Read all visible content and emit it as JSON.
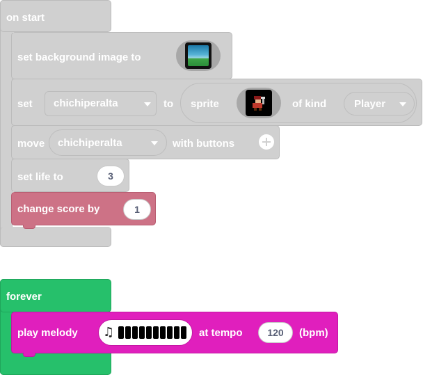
{
  "on_start": {
    "hat_label": "on start",
    "set_background": {
      "label": "set background image to",
      "image_icon": "background-image-thumbnail-icon"
    },
    "set_sprite": {
      "set_label": "set",
      "variable": "chichiperalta",
      "to_label": "to",
      "sprite_label": "sprite",
      "sprite_icon": "pixel-character-sprite-icon",
      "of_kind_label": "of kind",
      "kind": "Player"
    },
    "move": {
      "label": "move",
      "variable": "chichiperalta",
      "with_label": "with buttons",
      "expand_icon": "plus-circle-icon"
    },
    "set_life": {
      "label": "set life to",
      "value": "3"
    },
    "change_score": {
      "label": "change score by",
      "value": "1"
    }
  },
  "forever": {
    "hat_label": "forever",
    "play_melody": {
      "label": "play melody",
      "melody_icon": "music-note-icon",
      "tempo_label": "at tempo",
      "tempo": "120",
      "unit_label": "(bpm)"
    }
  },
  "colors": {
    "disabled_block": "#d0d0d0",
    "score_block": "#cd7286",
    "loop_block": "#26c06b",
    "music_block": "#e01fbd",
    "input_bg": "#ffffff",
    "input_text": "#575e75"
  }
}
